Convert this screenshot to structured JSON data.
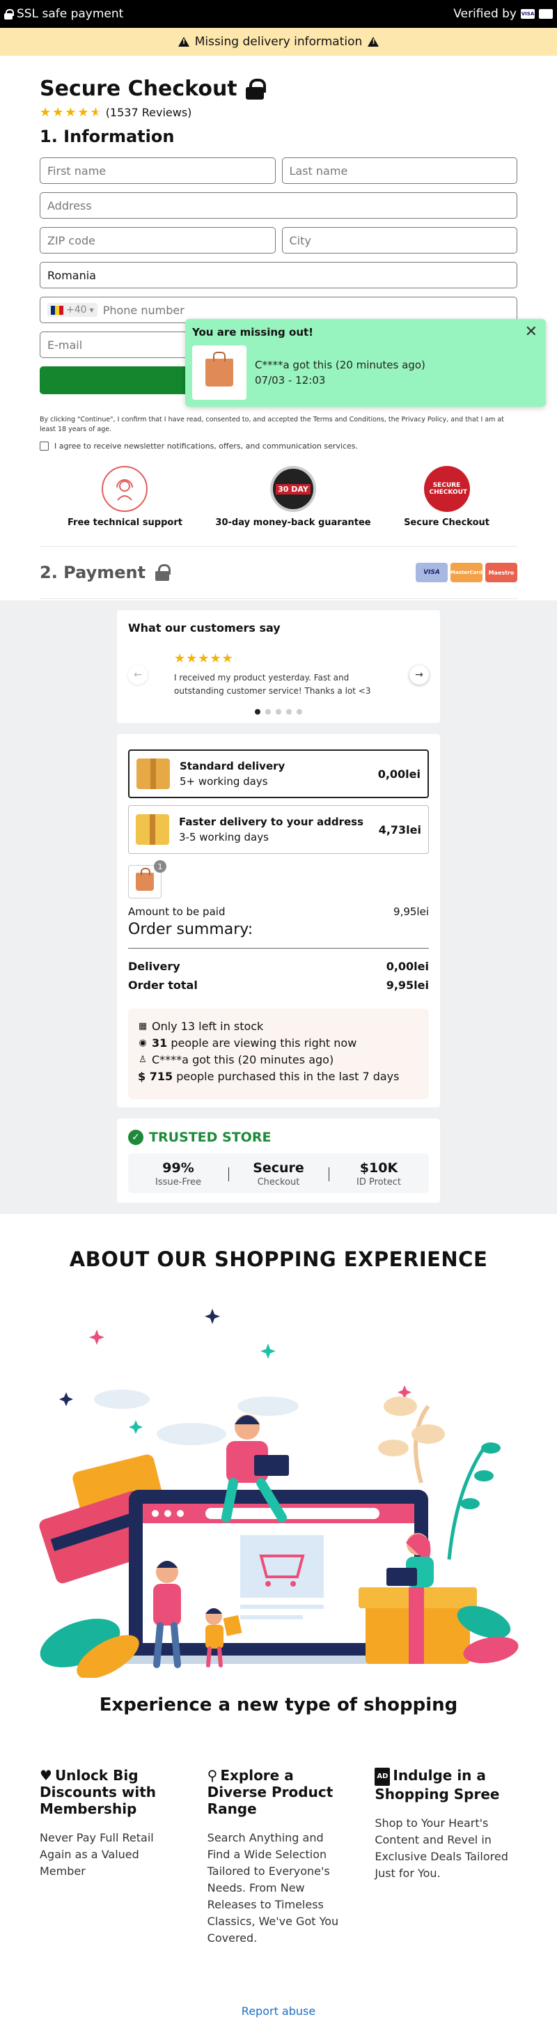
{
  "topbar": {
    "ssl_text": "SSL safe payment",
    "verified_text": "Verified by",
    "verified_card": "VISA"
  },
  "warning": {
    "text": "Missing delivery information"
  },
  "checkout": {
    "title": "Secure Checkout",
    "rating_stars": 4.5,
    "reviews_text": "(1537 Reviews)",
    "section1_title": "1. Information"
  },
  "form": {
    "first_name_placeholder": "First name",
    "last_name_placeholder": "Last name",
    "address_placeholder": "Address",
    "zip_placeholder": "ZIP code",
    "city_placeholder": "City",
    "country_value": "Romania",
    "phone_prefix": "+40",
    "phone_placeholder": "Phone number",
    "email_placeholder": "E-mail"
  },
  "legal": {
    "terms_text": "By clicking \"Continue\", I confirm that I have read, consented to, and accepted the Terms and Conditions, the Privacy Policy, and that I am at least 18 years of age.",
    "newsletter_text": "I agree to receive newsletter notifications, offers, and communication services."
  },
  "badges": [
    {
      "label": "Free technical support",
      "icon": "headset-icon"
    },
    {
      "label": "30-day money-back guarantee",
      "icon": "guarantee-seal-icon",
      "seal_text": "30 DAY"
    },
    {
      "label": "Secure Checkout",
      "icon": "secure-checkout-seal-icon",
      "seal_text": "SECURE CHECKOUT"
    }
  ],
  "payment": {
    "title": "2. Payment",
    "cards": [
      "VISA",
      "MasterCard",
      "Maestro"
    ]
  },
  "reviews": {
    "title": "What our customers say",
    "stars": "★★★★★",
    "text": "I received my product yesterday. Fast and outstanding customer service! Thanks a lot <3",
    "slide_count": 5,
    "active_slide": 1
  },
  "shipping": [
    {
      "name": "Standard delivery",
      "days": "5+ working days",
      "price": "0,00lei",
      "selected": true
    },
    {
      "name": "Faster delivery to your address",
      "days": "3-5 working days",
      "price": "4,73lei",
      "selected": false
    }
  ],
  "cart": {
    "quantity": "1"
  },
  "summary": {
    "amount_label": "Amount to be paid",
    "amount_value": "9,95lei",
    "title": "Order summary:",
    "delivery_label": "Delivery",
    "delivery_value": "0,00lei",
    "total_label": "Order total",
    "total_value": "9,95lei"
  },
  "social_proof": {
    "stock_text": "Only 13 left in stock",
    "viewers_count": "31",
    "viewers_text": " people are viewing this right now",
    "recent_text": "C****a got this (20 minutes ago)",
    "purchased_count": "$ 715",
    "purchased_text": " people purchased this in the last 7 days"
  },
  "trusted": {
    "title": "TRUSTED STORE",
    "stats": [
      {
        "value": "99%",
        "label": "Issue-Free"
      },
      {
        "value": "Secure",
        "label": "Checkout"
      },
      {
        "value": "$10K",
        "label": "ID Protect"
      }
    ]
  },
  "about": {
    "title": "ABOUT OUR SHOPPING EXPERIENCE",
    "subtitle": "Experience a new type of shopping",
    "features": [
      {
        "icon": "heart-icon",
        "title": "Unlock Big Discounts with Membership",
        "text": "Never Pay Full Retail Again as a Valued Member"
      },
      {
        "icon": "search-icon",
        "title": "Explore a Diverse Product Range",
        "text": "Search Anything and Find a Wide Selection Tailored to Everyone's Needs. From New Releases to Timeless Classics, We've Got You Covered."
      },
      {
        "icon": "ad-icon",
        "title": "Indulge in a Shopping Spree",
        "text": "Shop to Your Heart's Content and Revel in Exclusive Deals Tailored Just for You."
      }
    ]
  },
  "footer": {
    "report_link": "Report abuse"
  },
  "popup": {
    "title": "You are missing out!",
    "message": "C****a got this (20 minutes ago)",
    "time": "07/03 - 12:03"
  },
  "colors": {
    "accent_green": "#14862d",
    "warning_bg": "#fde7ad",
    "popup_bg": "#98f4be",
    "trusted_green": "#1d8a3a",
    "link_blue": "#1a6fc4"
  }
}
